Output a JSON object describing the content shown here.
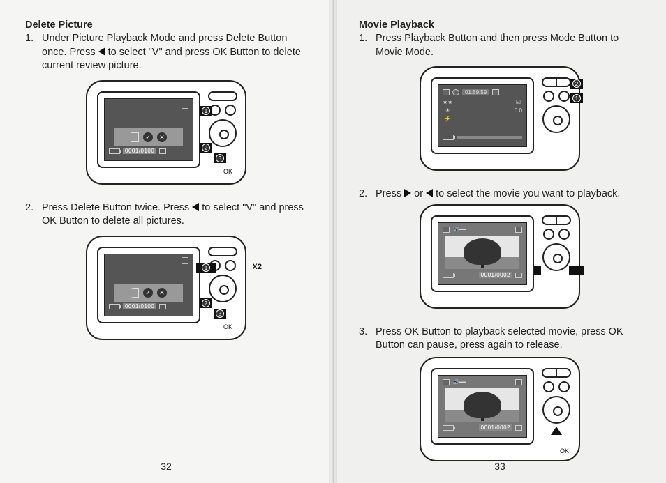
{
  "left": {
    "title": "Delete Picture",
    "step1": {
      "num": "1.",
      "text_a": "Under Picture Playback Mode and press Delete Button once. Press ",
      "text_b": " to select \"V\" and press OK Button to delete current review picture."
    },
    "fig1": {
      "counter": "0001/0100",
      "ok": "OK",
      "marker1": "1",
      "marker2": "2",
      "marker3": "3"
    },
    "step2": {
      "num": "2.",
      "text_a": "Press Delete Button twice. Press ",
      "text_b": " to select \"V\" and press OK Button to delete all pictures."
    },
    "fig2": {
      "counter": "0001/0100",
      "ok": "OK",
      "x2": "X2",
      "marker1": "1",
      "marker2": "2",
      "marker3": "3"
    },
    "page_num": "32"
  },
  "right": {
    "title": "Movie Playback",
    "step1": {
      "num": "1.",
      "text": "Press Playback Button and then press Mode Button to Movie Mode."
    },
    "fig1": {
      "time": "01:59:59",
      "marker1": "1",
      "marker2": "2",
      "ev": "0.0"
    },
    "step2": {
      "num": "2.",
      "text_a": "Press ",
      "text_b": " or ",
      "text_c": " to select the movie you want to playback."
    },
    "fig2": {
      "counter": "0001/0002"
    },
    "step3": {
      "num": "3.",
      "text": "Press OK Button to playback selected movie, press OK Button can pause, press again to release."
    },
    "fig3": {
      "counter": "0001/0002",
      "ok": "OK"
    },
    "page_num": "33"
  }
}
